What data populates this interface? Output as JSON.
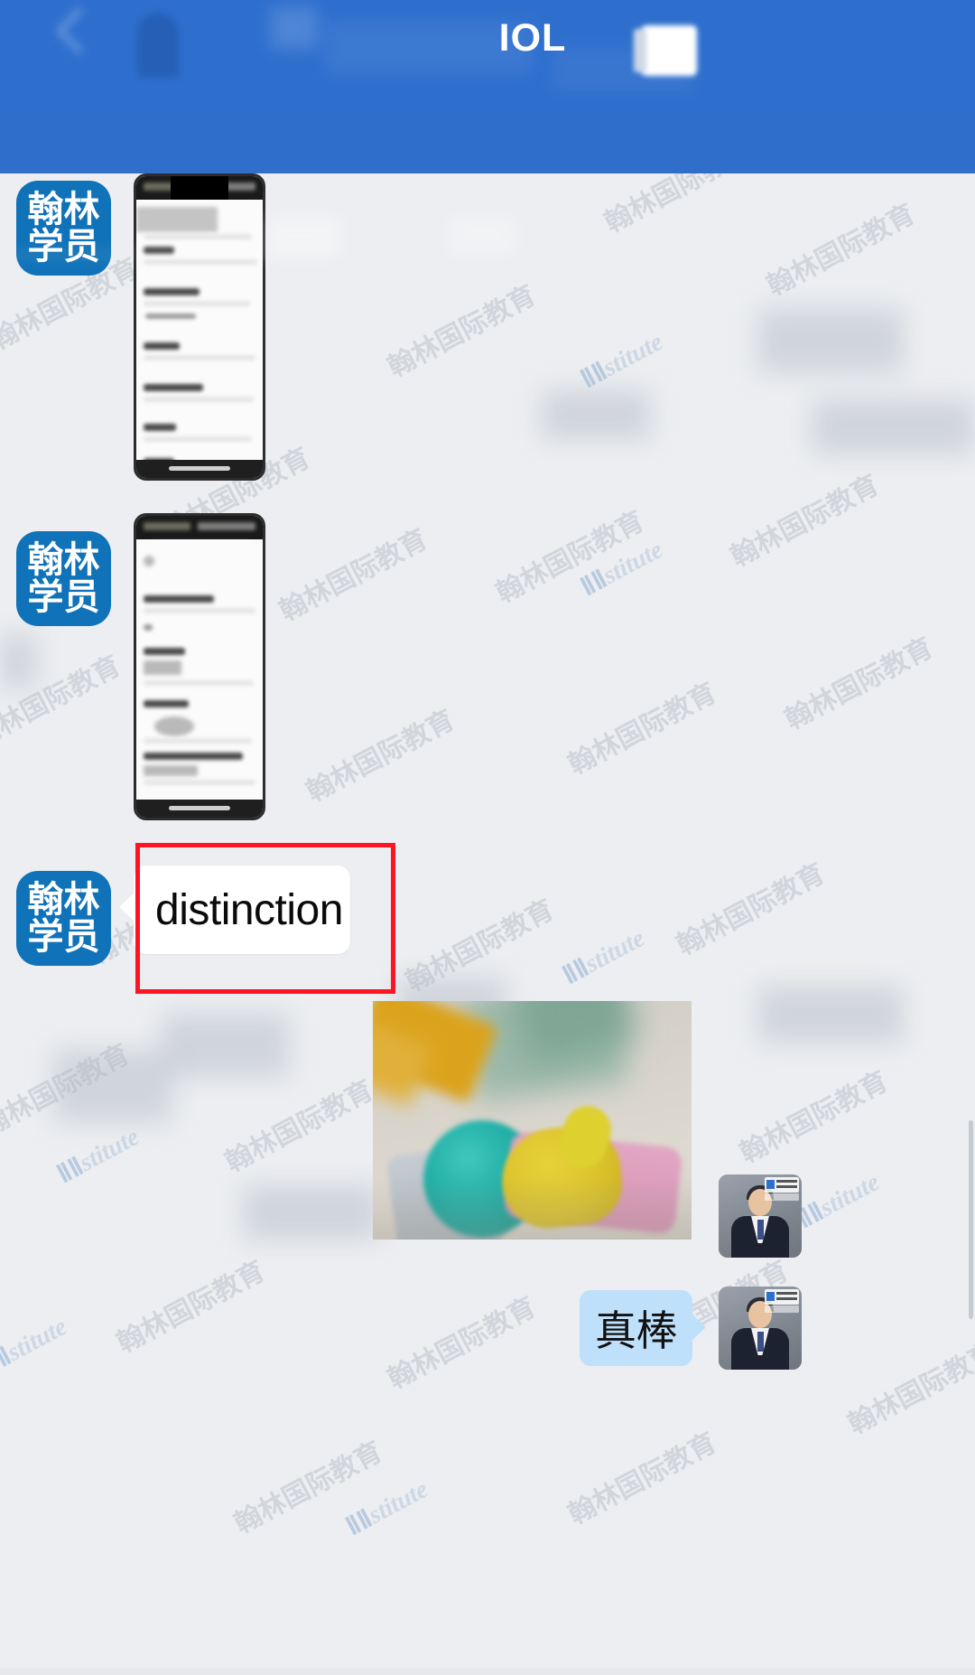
{
  "header": {
    "title": "IOL",
    "back_icon": "back-arrow-icon",
    "menu_icon": "more-options-icon",
    "bg_color": "#2e6fce"
  },
  "chat": {
    "background_color": "#eceef1",
    "watermark_cn": "翰林国际教育",
    "watermark_en_prefix": "lin",
    "watermark_en": "stitute",
    "messages": [
      {
        "id": "msg-1",
        "side": "left",
        "sender_avatar_line1": "翰林",
        "sender_avatar_line2": "学员",
        "type": "image",
        "content_label": "phone-screenshot-1"
      },
      {
        "id": "msg-2",
        "side": "left",
        "sender_avatar_line1": "翰林",
        "sender_avatar_line2": "学员",
        "type": "image",
        "content_label": "phone-screenshot-2"
      },
      {
        "id": "msg-3",
        "side": "left",
        "sender_avatar_line1": "翰林",
        "sender_avatar_line2": "学员",
        "type": "text",
        "text": "distinction",
        "highlighted": true,
        "highlight_color": "#ff1424"
      },
      {
        "id": "msg-4",
        "side": "right",
        "type": "image",
        "content_label": "thumbs-up-clay-photo"
      },
      {
        "id": "msg-5",
        "side": "right",
        "type": "text",
        "text": "真棒",
        "bubble_color": "#bfe0fb"
      }
    ]
  },
  "avatars": {
    "student_label_line1": "翰林",
    "student_label_line2": "学员",
    "student_bg_color": "#1072b8",
    "teacher_label": "teacher-photo-avatar"
  }
}
